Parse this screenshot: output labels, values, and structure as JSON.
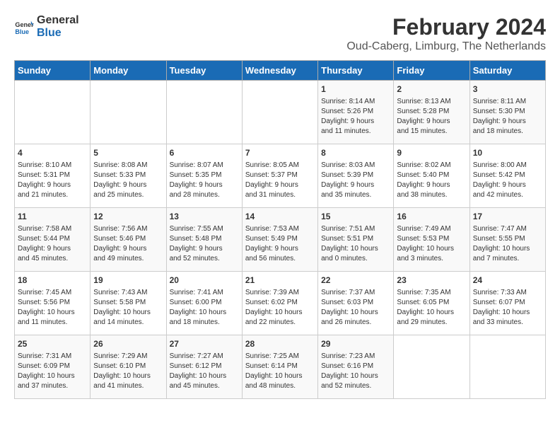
{
  "header": {
    "logo_line1": "General",
    "logo_line2": "Blue",
    "main_title": "February 2024",
    "subtitle": "Oud-Caberg, Limburg, The Netherlands"
  },
  "days_of_week": [
    "Sunday",
    "Monday",
    "Tuesday",
    "Wednesday",
    "Thursday",
    "Friday",
    "Saturday"
  ],
  "weeks": [
    [
      {
        "day": "",
        "info": ""
      },
      {
        "day": "",
        "info": ""
      },
      {
        "day": "",
        "info": ""
      },
      {
        "day": "",
        "info": ""
      },
      {
        "day": "1",
        "info": "Sunrise: 8:14 AM\nSunset: 5:26 PM\nDaylight: 9 hours\nand 11 minutes."
      },
      {
        "day": "2",
        "info": "Sunrise: 8:13 AM\nSunset: 5:28 PM\nDaylight: 9 hours\nand 15 minutes."
      },
      {
        "day": "3",
        "info": "Sunrise: 8:11 AM\nSunset: 5:30 PM\nDaylight: 9 hours\nand 18 minutes."
      }
    ],
    [
      {
        "day": "4",
        "info": "Sunrise: 8:10 AM\nSunset: 5:31 PM\nDaylight: 9 hours\nand 21 minutes."
      },
      {
        "day": "5",
        "info": "Sunrise: 8:08 AM\nSunset: 5:33 PM\nDaylight: 9 hours\nand 25 minutes."
      },
      {
        "day": "6",
        "info": "Sunrise: 8:07 AM\nSunset: 5:35 PM\nDaylight: 9 hours\nand 28 minutes."
      },
      {
        "day": "7",
        "info": "Sunrise: 8:05 AM\nSunset: 5:37 PM\nDaylight: 9 hours\nand 31 minutes."
      },
      {
        "day": "8",
        "info": "Sunrise: 8:03 AM\nSunset: 5:39 PM\nDaylight: 9 hours\nand 35 minutes."
      },
      {
        "day": "9",
        "info": "Sunrise: 8:02 AM\nSunset: 5:40 PM\nDaylight: 9 hours\nand 38 minutes."
      },
      {
        "day": "10",
        "info": "Sunrise: 8:00 AM\nSunset: 5:42 PM\nDaylight: 9 hours\nand 42 minutes."
      }
    ],
    [
      {
        "day": "11",
        "info": "Sunrise: 7:58 AM\nSunset: 5:44 PM\nDaylight: 9 hours\nand 45 minutes."
      },
      {
        "day": "12",
        "info": "Sunrise: 7:56 AM\nSunset: 5:46 PM\nDaylight: 9 hours\nand 49 minutes."
      },
      {
        "day": "13",
        "info": "Sunrise: 7:55 AM\nSunset: 5:48 PM\nDaylight: 9 hours\nand 52 minutes."
      },
      {
        "day": "14",
        "info": "Sunrise: 7:53 AM\nSunset: 5:49 PM\nDaylight: 9 hours\nand 56 minutes."
      },
      {
        "day": "15",
        "info": "Sunrise: 7:51 AM\nSunset: 5:51 PM\nDaylight: 10 hours\nand 0 minutes."
      },
      {
        "day": "16",
        "info": "Sunrise: 7:49 AM\nSunset: 5:53 PM\nDaylight: 10 hours\nand 3 minutes."
      },
      {
        "day": "17",
        "info": "Sunrise: 7:47 AM\nSunset: 5:55 PM\nDaylight: 10 hours\nand 7 minutes."
      }
    ],
    [
      {
        "day": "18",
        "info": "Sunrise: 7:45 AM\nSunset: 5:56 PM\nDaylight: 10 hours\nand 11 minutes."
      },
      {
        "day": "19",
        "info": "Sunrise: 7:43 AM\nSunset: 5:58 PM\nDaylight: 10 hours\nand 14 minutes."
      },
      {
        "day": "20",
        "info": "Sunrise: 7:41 AM\nSunset: 6:00 PM\nDaylight: 10 hours\nand 18 minutes."
      },
      {
        "day": "21",
        "info": "Sunrise: 7:39 AM\nSunset: 6:02 PM\nDaylight: 10 hours\nand 22 minutes."
      },
      {
        "day": "22",
        "info": "Sunrise: 7:37 AM\nSunset: 6:03 PM\nDaylight: 10 hours\nand 26 minutes."
      },
      {
        "day": "23",
        "info": "Sunrise: 7:35 AM\nSunset: 6:05 PM\nDaylight: 10 hours\nand 29 minutes."
      },
      {
        "day": "24",
        "info": "Sunrise: 7:33 AM\nSunset: 6:07 PM\nDaylight: 10 hours\nand 33 minutes."
      }
    ],
    [
      {
        "day": "25",
        "info": "Sunrise: 7:31 AM\nSunset: 6:09 PM\nDaylight: 10 hours\nand 37 minutes."
      },
      {
        "day": "26",
        "info": "Sunrise: 7:29 AM\nSunset: 6:10 PM\nDaylight: 10 hours\nand 41 minutes."
      },
      {
        "day": "27",
        "info": "Sunrise: 7:27 AM\nSunset: 6:12 PM\nDaylight: 10 hours\nand 45 minutes."
      },
      {
        "day": "28",
        "info": "Sunrise: 7:25 AM\nSunset: 6:14 PM\nDaylight: 10 hours\nand 48 minutes."
      },
      {
        "day": "29",
        "info": "Sunrise: 7:23 AM\nSunset: 6:16 PM\nDaylight: 10 hours\nand 52 minutes."
      },
      {
        "day": "",
        "info": ""
      },
      {
        "day": "",
        "info": ""
      }
    ]
  ]
}
